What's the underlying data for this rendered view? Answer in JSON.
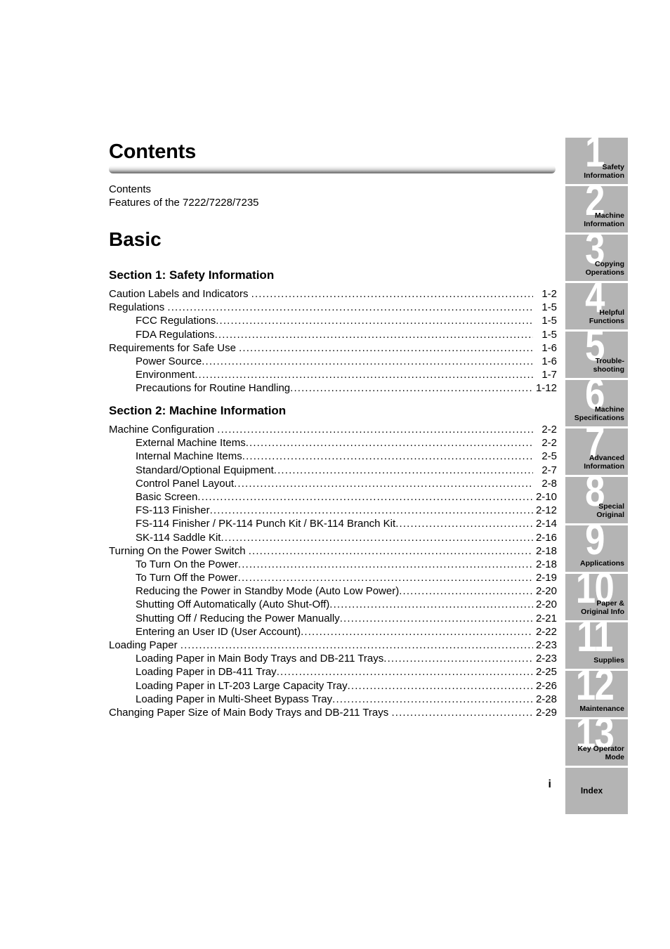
{
  "header": {
    "title": "Contents",
    "intro_lines": [
      "Contents",
      "Features of the 7222/7228/7235"
    ]
  },
  "book": {
    "part_title": "Basic",
    "folio": "i"
  },
  "sections": [
    {
      "heading": "Section 1: Safety Information",
      "entries": [
        {
          "level": 1,
          "label": "Caution Labels and Indicators",
          "page": "1-2"
        },
        {
          "level": 1,
          "label": "Regulations",
          "page": "1-5"
        },
        {
          "level": 2,
          "label": "FCC Regulations",
          "page": "1-5"
        },
        {
          "level": 2,
          "label": "FDA Regulations",
          "page": "1-5"
        },
        {
          "level": 1,
          "label": "Requirements for Safe Use",
          "page": "1-6"
        },
        {
          "level": 2,
          "label": "Power Source",
          "page": "1-6"
        },
        {
          "level": 2,
          "label": "Environment",
          "page": "1-7"
        },
        {
          "level": 2,
          "label": "Precautions for Routine Handling",
          "page": "1-12"
        }
      ]
    },
    {
      "heading": "Section 2: Machine Information",
      "entries": [
        {
          "level": 1,
          "label": "Machine Configuration",
          "page": "2-2"
        },
        {
          "level": 2,
          "label": "External Machine Items",
          "page": "2-2"
        },
        {
          "level": 2,
          "label": "Internal Machine Items",
          "page": "2-5"
        },
        {
          "level": 2,
          "label": "Standard/Optional Equipment",
          "page": "2-7"
        },
        {
          "level": 2,
          "label": "Control Panel Layout",
          "page": "2-8"
        },
        {
          "level": 2,
          "label": "Basic Screen",
          "page": "2-10"
        },
        {
          "level": 2,
          "label": "FS-113 Finisher",
          "page": "2-12"
        },
        {
          "level": 2,
          "label": "FS-114 Finisher / PK-114 Punch Kit / BK-114 Branch Kit",
          "page": "2-14"
        },
        {
          "level": 2,
          "label": "SK-114 Saddle Kit",
          "page": "2-16"
        },
        {
          "level": 1,
          "label": "Turning On the Power Switch",
          "page": "2-18"
        },
        {
          "level": 2,
          "label": "To Turn On the Power",
          "page": "2-18"
        },
        {
          "level": 2,
          "label": "To Turn Off the Power",
          "page": "2-19"
        },
        {
          "level": 2,
          "label": "Reducing the Power in Standby Mode (Auto Low Power)",
          "page": "2-20"
        },
        {
          "level": 2,
          "label": "Shutting Off Automatically (Auto Shut-Off)",
          "page": "2-20"
        },
        {
          "level": 2,
          "label": "Shutting Off / Reducing the Power Manually",
          "page": "2-21"
        },
        {
          "level": 2,
          "label": "Entering an User ID (User Account)",
          "page": "2-22"
        },
        {
          "level": 1,
          "label": "Loading Paper",
          "page": "2-23"
        },
        {
          "level": 2,
          "label": "Loading Paper in Main Body Trays and DB-211 Trays",
          "page": "2-23"
        },
        {
          "level": 2,
          "label": "Loading Paper in DB-411 Tray",
          "page": "2-25"
        },
        {
          "level": 2,
          "label": "Loading Paper in LT-203 Large Capacity Tray",
          "page": "2-26"
        },
        {
          "level": 2,
          "label": "Loading Paper in Multi-Sheet Bypass Tray",
          "page": "2-28"
        },
        {
          "level": 1,
          "label": "Changing Paper Size of Main Body Trays and DB-211 Trays",
          "page": "2-29"
        }
      ]
    }
  ],
  "side_tabs": [
    {
      "number": "1",
      "label": "Safety\nInformation"
    },
    {
      "number": "2",
      "label": "Machine\nInformation"
    },
    {
      "number": "3",
      "label": "Copying\nOperations"
    },
    {
      "number": "4",
      "label": "Helpful\nFunctions"
    },
    {
      "number": "5",
      "label": "Trouble-\nshooting"
    },
    {
      "number": "6",
      "label": "Machine\nSpecifications"
    },
    {
      "number": "7",
      "label": "Advanced\nInformation"
    },
    {
      "number": "8",
      "label": "Special\nOriginal"
    },
    {
      "number": "9",
      "label": "Applications"
    },
    {
      "number": "10",
      "label": "Paper &\nOriginal Info"
    },
    {
      "number": "11",
      "label": "Supplies"
    },
    {
      "number": "12",
      "label": "Maintenance"
    },
    {
      "number": "13",
      "label": "Key Operator\nMode"
    },
    {
      "number": "",
      "label": "Index"
    }
  ],
  "colors": {
    "tab_background": "#b4b4b4",
    "tab_number": "#ffffff",
    "text": "#000000",
    "page_background": "#ffffff"
  }
}
